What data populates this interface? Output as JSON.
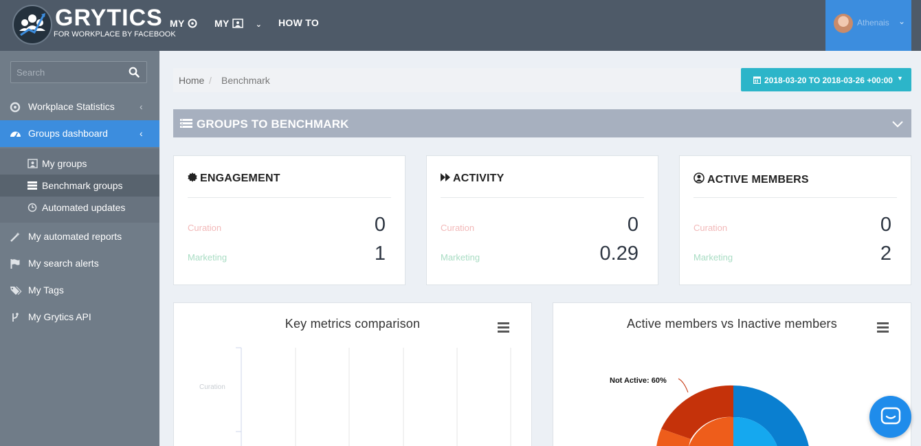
{
  "header": {
    "logo_title": "GRYTICS",
    "logo_subtitle": "FOR WORKPLACE BY FACEBOOK",
    "nav": [
      {
        "label": "MY",
        "icon": "workplace-icon"
      },
      {
        "label": "MY",
        "icon": "groups-icon"
      },
      {
        "label": "HOW TO"
      }
    ],
    "user_name": "Athenais",
    "accent": "#3c8dde"
  },
  "sidebar": {
    "search_placeholder": "Search",
    "items": [
      {
        "label": "Workplace Statistics",
        "icon": "workplace-icon"
      },
      {
        "label": "Groups dashboard",
        "icon": "dashboard-icon",
        "active": true
      },
      {
        "label": "My automated reports",
        "icon": "magic-wand-icon"
      },
      {
        "label": "My search alerts",
        "icon": "flag-icon"
      },
      {
        "label": "My Tags",
        "icon": "tags-icon"
      },
      {
        "label": "My Grytics API",
        "icon": "code-fork-icon"
      }
    ],
    "subitems": [
      {
        "label": "My groups",
        "icon": "groups-icon"
      },
      {
        "label": "Benchmark groups",
        "icon": "list-icon",
        "active": true
      },
      {
        "label": "Automated updates",
        "icon": "clock-icon"
      }
    ]
  },
  "breadcrumb": {
    "home": "Home",
    "separator": "/",
    "current": "Benchmark"
  },
  "date_range": "2018-03-20 TO 2018-03-26 +00:00",
  "benchmark_bar": {
    "title": "GROUPS TO BENCHMARK"
  },
  "cards": [
    {
      "title": "ENGAGEMENT",
      "icon": "certificate-icon",
      "rows": [
        {
          "label": "Curation",
          "value": "0"
        },
        {
          "label": "Marketing",
          "value": "1"
        }
      ]
    },
    {
      "title": "ACTIVITY",
      "icon": "fast-forward-icon",
      "rows": [
        {
          "label": "Curation",
          "value": "0"
        },
        {
          "label": "Marketing",
          "value": "0.29"
        }
      ]
    },
    {
      "title": "ACTIVE MEMBERS",
      "icon": "user-circle-icon",
      "rows": [
        {
          "label": "Curation",
          "value": "0"
        },
        {
          "label": "Marketing",
          "value": "2"
        }
      ]
    }
  ],
  "panels": {
    "key_metrics": {
      "title": "Key metrics comparison",
      "axis_category": "Curation"
    },
    "active_members": {
      "title": "Active members vs Inactive members",
      "pie_label": "Not Active: 60%"
    }
  },
  "colors": {
    "curation": "#f2b8b8",
    "marketing": "#a8dcc3",
    "pie_active_dark": "#0a7fd0",
    "pie_active_light": "#15a8ef",
    "pie_inactive_dark": "#c5320a",
    "pie_inactive_light": "#ee5d1b"
  }
}
